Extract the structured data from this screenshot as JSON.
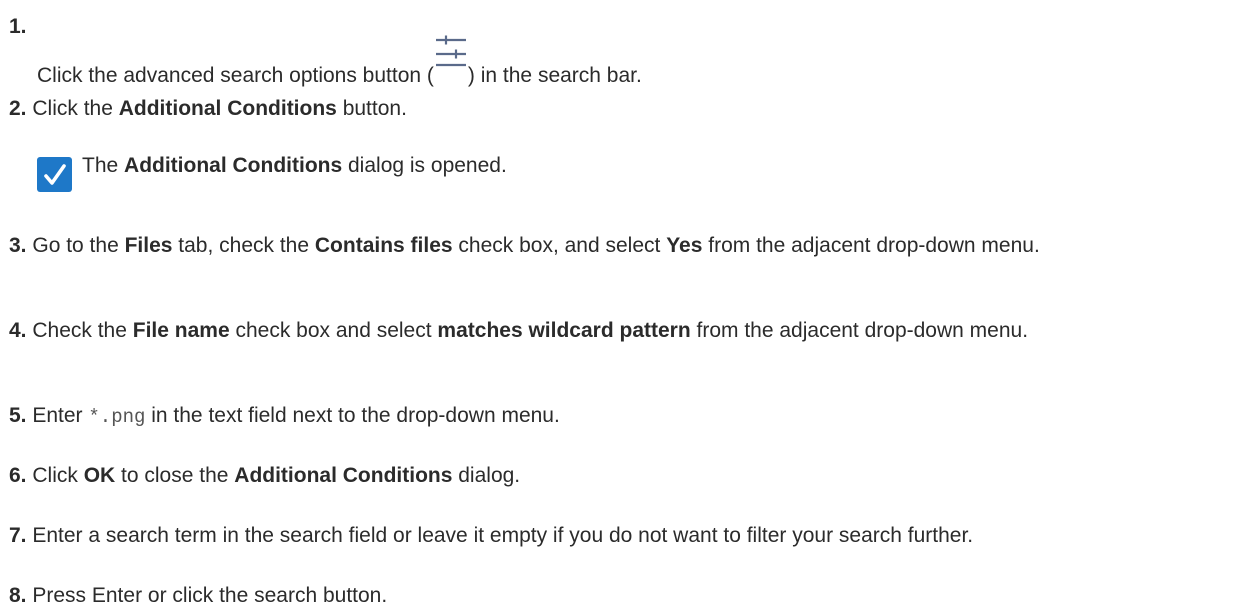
{
  "steps": [
    {
      "number": "1.",
      "before": "Click the advanced search options button (",
      "icon": "advanced-search-options-icon",
      "after": ") in the search bar."
    },
    {
      "number": "2.",
      "t1": "Click the ",
      "b1": "Additional Conditions",
      "t2": " button."
    },
    {
      "number": "3.",
      "t1": "Go to the ",
      "b1": "Files",
      "t2": " tab, check the ",
      "b2": "Contains files",
      "t3": " check box, and select ",
      "b3": "Yes",
      "t4": " from the adjacent drop-down menu."
    },
    {
      "number": "4.",
      "t1": "Check the ",
      "b1": "File name",
      "t2": " check box and select ",
      "b2": "matches wildcard pattern",
      "t3": " from the adjacent drop-down menu."
    },
    {
      "number": "5.",
      "t1": "Enter ",
      "code": "*.png",
      "t2": " in the text field next to the drop-down menu."
    },
    {
      "number": "6.",
      "t1": "Click ",
      "b1": "OK",
      "t2": " to close the ",
      "b2": "Additional Conditions",
      "t3": " dialog."
    },
    {
      "number": "7.",
      "t1": "Enter a search term in the search field or leave it empty if you do not want to filter your search further."
    },
    {
      "number": "8.",
      "t1": "Press Enter or click the search button."
    }
  ],
  "result": {
    "icon": "checkmark-icon",
    "t1": "The ",
    "b1": "Additional Conditions",
    "t2": " dialog is opened."
  },
  "colors": {
    "text": "#2b2b2b",
    "checkmark_bg": "#1e78c8",
    "icon_stroke": "#5a6a8a"
  }
}
